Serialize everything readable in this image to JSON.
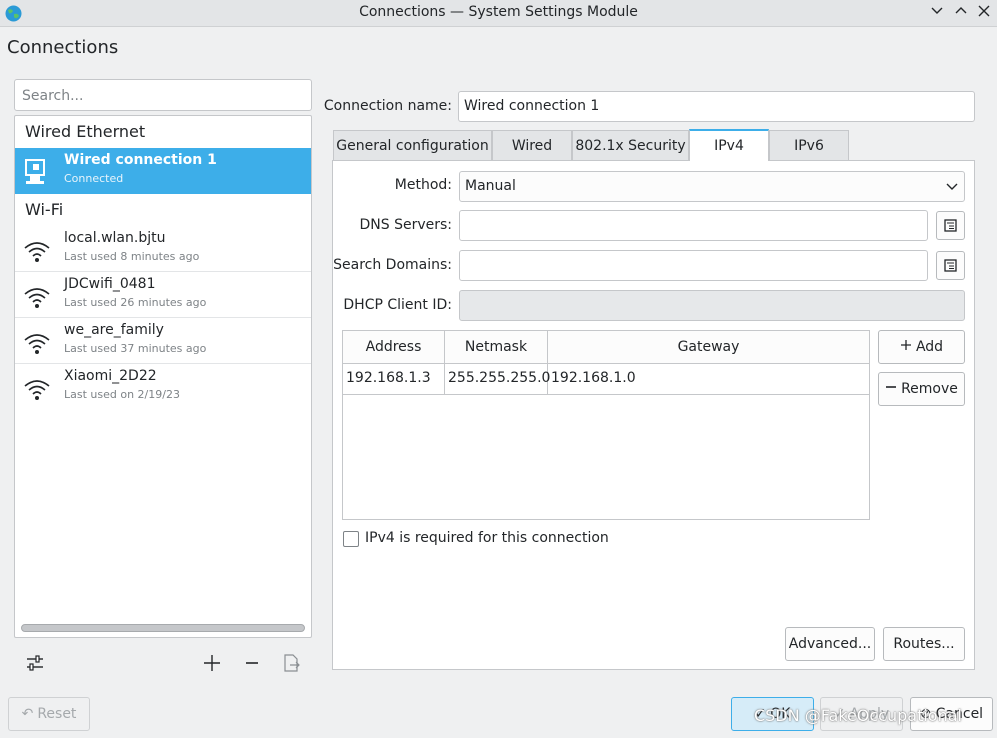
{
  "window": {
    "title": "Connections — System Settings Module",
    "page_title": "Connections"
  },
  "sidebar": {
    "search_placeholder": "Search...",
    "categories": {
      "wired": "Wired Ethernet",
      "wifi": "Wi-Fi"
    },
    "wired_connections": [
      {
        "name": "Wired connection 1",
        "status": "Connected",
        "selected": true
      }
    ],
    "wifi_connections": [
      {
        "name": "local.wlan.bjtu",
        "status": "Last used 8 minutes ago"
      },
      {
        "name": "JDCwifi_0481",
        "status": "Last used 26 minutes ago"
      },
      {
        "name": "we_are_family",
        "status": "Last used 37 minutes ago"
      },
      {
        "name": "Xiaomi_2D22",
        "status": "Last used on 2/19/23"
      }
    ],
    "toolbar_icons": [
      "configure-icon",
      "add-icon",
      "remove-icon",
      "export-icon"
    ]
  },
  "form": {
    "connection_name_label": "Connection name:",
    "connection_name_value": "Wired connection 1",
    "tabs": [
      "General configuration",
      "Wired",
      "802.1x Security",
      "IPv4",
      "IPv6"
    ],
    "active_tab": "IPv4",
    "method_label": "Method:",
    "method_value": "Manual",
    "dns_label": "DNS Servers:",
    "dns_value": "",
    "search_domains_label": "Search Domains:",
    "search_domains_value": "",
    "dhcp_label": "DHCP Client ID:",
    "dhcp_value": "",
    "address_table": {
      "columns": [
        "Address",
        "Netmask",
        "Gateway"
      ],
      "rows": [
        [
          "192.168.1.3",
          "255.255.255.0",
          "192.168.1.0"
        ]
      ]
    },
    "add_button": "Add",
    "remove_button": "Remove",
    "ipv4_required_label": "IPv4 is required for this connection",
    "ipv4_required_checked": false,
    "advanced_button": "Advanced...",
    "routes_button": "Routes..."
  },
  "footer": {
    "reset_button": "Reset",
    "ok_button": "OK",
    "apply_button": "Apply",
    "cancel_button": "Cancel"
  },
  "watermark": "CSDN @FakeOccupational",
  "colors": {
    "accent": "#3daee9",
    "window_bg": "#eff0f1"
  }
}
